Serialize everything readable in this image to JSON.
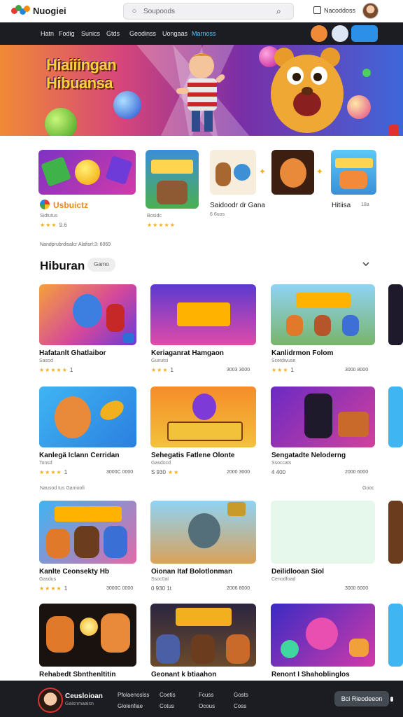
{
  "header": {
    "logo_text": "Nuogiei",
    "search_placeholder": "Soupoods",
    "account_label": "Nacoddoss"
  },
  "nav": {
    "items": [
      "Hatn",
      "Fodig",
      "Sunics",
      "Gtds",
      "Geodinss",
      "Uongaas",
      "Marnoss"
    ],
    "active_index": 6
  },
  "hero": {
    "title_line1": "Hiaiiingan",
    "title_line2": "Hibuansa",
    "slides": 5
  },
  "featured": [
    {
      "label": "Usbuictz",
      "sub": "Sidtutus",
      "stars": 3,
      "count": "9.6"
    },
    {
      "label": "",
      "sub": "Bosidc",
      "stars": 5,
      "count": ""
    },
    {
      "label": "Saidoodr dr Gana",
      "sub": "6 6uos",
      "stars": 0,
      "count": ""
    },
    {
      "label": "Hitiisa",
      "sub": "",
      "stars": 0,
      "count": "18a"
    }
  ],
  "meta_line": "Nandprubrdisalcr Alafisrl:3: 6069",
  "section": {
    "title": "Hiburan",
    "chip": "Gamo"
  },
  "cards_row1": [
    {
      "title": "Hafatanlt Ghatlaibor",
      "sub": "Sasod",
      "stars": 5,
      "num": "1",
      "price": ""
    },
    {
      "title": "Keriaganrat Hamgaon",
      "sub": "Gunutsi",
      "stars": 3,
      "num": "1",
      "price": "3003 3000"
    },
    {
      "title": "Kanlidrmon Folom",
      "sub": "Scetdwuse",
      "stars": 3,
      "num": "1",
      "price": "3000 8000"
    }
  ],
  "cards_row2": [
    {
      "title": "Kanlegä Iclann Cerridan",
      "sub": "Tonsd",
      "stars": 4,
      "num": "1",
      "price": "3000C 0000"
    },
    {
      "title": "Sehegatis Fatlene Olonte",
      "sub": "Gasdocd",
      "stars": 2,
      "num": "S 930",
      "price": "2000 3000"
    },
    {
      "title": "Sengatadte Neloderng",
      "sub": "Ssoccats",
      "stars": 0,
      "num": "4 400",
      "price": "2000 6000"
    }
  ],
  "divider": {
    "left": "Nausod tus Gamoofi",
    "right": "Gooc"
  },
  "cards_row3": [
    {
      "title": "Kanlte Ceonsekty Hb",
      "sub": "Gasdus",
      "stars": 4,
      "num": "1",
      "price": "3000C 0000"
    },
    {
      "title": "Oionan Itaf Bolotlonman",
      "sub": "Ssoc0al",
      "stars": 0,
      "num": "0 930 1t",
      "price": "2006 8000"
    },
    {
      "title": "Deilidlooan Siol",
      "sub": "Cenodfoad",
      "stars": 0,
      "num": "",
      "price": "3000 6000"
    }
  ],
  "cards_row4": [
    {
      "title": "Rehabedt Sbnthenltitin"
    },
    {
      "title": "Geonant k btiaahon"
    },
    {
      "title": "Renont I Shahoblinglos"
    }
  ],
  "bottom": {
    "name": "Ceusloioan",
    "sub": "Gaisnmaaisn",
    "links_top": [
      "Pfolaenoslss",
      "Coetis",
      "Fcuss",
      "Gosts"
    ],
    "links_bottom": [
      "Glolenfiae",
      "Cotus",
      "Ocous",
      "Coss"
    ],
    "button": "Bci Rieodeeon"
  },
  "colors": {
    "accent": "#5fc0ff",
    "star": "#f2b01e",
    "dark": "#1b1d22"
  }
}
